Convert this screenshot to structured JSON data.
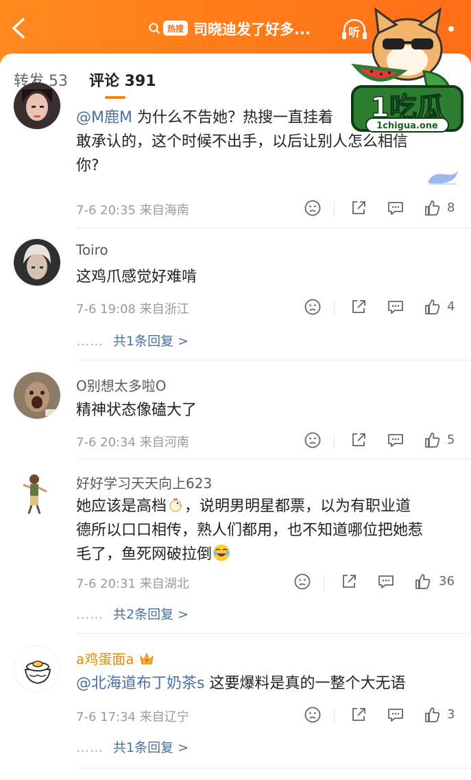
{
  "header": {
    "hot_badge": "热搜",
    "topic_title": "司晓迪发了好多...",
    "listen_label": "听"
  },
  "tabs": {
    "repost": "转发 53",
    "comments": "评论 391"
  },
  "watermark": {
    "brand": "1吃瓜",
    "url": "1chigua.one"
  },
  "comments": [
    {
      "mention": "@M鹿M",
      "text_line1": " 为什么不告她？热搜一直挂着",
      "text_line2": "敢承认的，这个时候不出手，以后让别人怎么相信",
      "text_line3": "你?",
      "time": "7-6 20:35",
      "location": "来自海南",
      "likes": "8"
    },
    {
      "name": "Toiro",
      "text": "这鸡爪感觉好难啃",
      "time": "7-6 19:08",
      "location": "来自浙江",
      "likes": "4",
      "replies": "共1条回复 >"
    },
    {
      "name": "O别想太多啦O",
      "text": "精神状态像磕大了",
      "time": "7-6 20:34",
      "location": "来自河南",
      "likes": "5"
    },
    {
      "name": "好好学习天天向上623",
      "text_line1": "她应该是高档",
      "text_line1b": "，说明男明星都票，以为有职业道",
      "text_line2": "德所以口口相传，熟人们都用，也不知道哪位把她惹",
      "text_line3": "毛了，鱼死网破拉倒",
      "time": "7-6 20:31",
      "location": "来自湖北",
      "likes": "36",
      "replies": "共2条回复 >"
    },
    {
      "name": "a鸡蛋面a",
      "mention": "@北海道布丁奶茶s",
      "text": " 这要爆料是真的一整个大无语",
      "time": "7-6 17:34",
      "location": "来自辽宁",
      "likes": "3",
      "replies": "共1条回复 >"
    }
  ],
  "reply_dots": "……",
  "colors": {
    "accent": "#ff8200",
    "header": "#ff7a1a",
    "link": "#4a6fa3"
  }
}
